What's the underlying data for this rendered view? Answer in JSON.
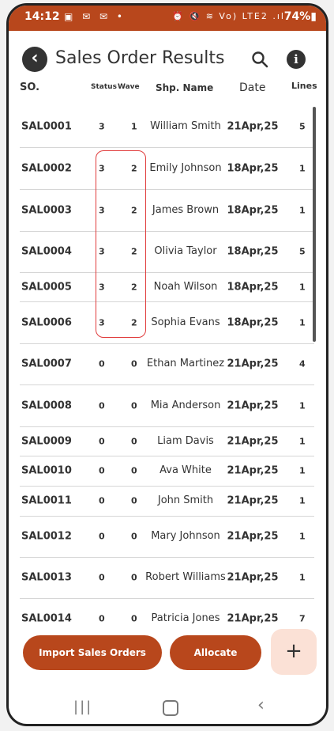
{
  "statusbar": {
    "time": "14:12",
    "left_icons": "▣ ✉ ✉ •",
    "right_icons": "⏰ 🔇 ≋ Vo) LTE2 .ıl",
    "battery": "74%▮"
  },
  "header": {
    "title": "Sales Order Results",
    "back_icon": "back-arrow-icon",
    "search_icon": "search-icon",
    "info_icon": "info-icon"
  },
  "columns": {
    "so": "SO.",
    "status": "Status",
    "wave": "Wave",
    "name": "Shp. Name",
    "date": "Date",
    "lines": "Lines"
  },
  "rows": [
    {
      "so": "SAL0001",
      "status": "3",
      "wave": "1",
      "name": "William Smith",
      "date": "21Apr,25",
      "lines": "5"
    },
    {
      "so": "SAL0002",
      "status": "3",
      "wave": "2",
      "name": "Emily Johnson",
      "date": "18Apr,25",
      "lines": "1"
    },
    {
      "so": "SAL0003",
      "status": "3",
      "wave": "2",
      "name": "James Brown",
      "date": "18Apr,25",
      "lines": "1"
    },
    {
      "so": "SAL0004",
      "status": "3",
      "wave": "2",
      "name": "Olivia Taylor",
      "date": "18Apr,25",
      "lines": "5"
    },
    {
      "so": "SAL0005",
      "status": "3",
      "wave": "2",
      "name": "Noah Wilson",
      "date": "18Apr,25",
      "lines": "1"
    },
    {
      "so": "SAL0006",
      "status": "3",
      "wave": "2",
      "name": "Sophia Evans",
      "date": "18Apr,25",
      "lines": "1"
    },
    {
      "so": "SAL0007",
      "status": "0",
      "wave": "0",
      "name": "Ethan Martinez",
      "date": "21Apr,25",
      "lines": "4"
    },
    {
      "so": "SAL0008",
      "status": "0",
      "wave": "0",
      "name": "Mia Anderson",
      "date": "21Apr,25",
      "lines": "1"
    },
    {
      "so": "SAL0009",
      "status": "0",
      "wave": "0",
      "name": "Liam Davis",
      "date": "21Apr,25",
      "lines": "1"
    },
    {
      "so": "SAL0010",
      "status": "0",
      "wave": "0",
      "name": "Ava White",
      "date": "21Apr,25",
      "lines": "1"
    },
    {
      "so": "SAL0011",
      "status": "0",
      "wave": "0",
      "name": "John Smith",
      "date": "21Apr,25",
      "lines": "1"
    },
    {
      "so": "SAL0012",
      "status": "0",
      "wave": "0",
      "name": "Mary Johnson",
      "date": "21Apr,25",
      "lines": "1"
    },
    {
      "so": "SAL0013",
      "status": "0",
      "wave": "0",
      "name": "Robert Williams",
      "date": "21Apr,25",
      "lines": "1"
    },
    {
      "so": "SAL0014",
      "status": "0",
      "wave": "0",
      "name": "Patricia Jones",
      "date": "21Apr,25",
      "lines": "7"
    }
  ],
  "buttons": {
    "import": "Import Sales Orders",
    "allocate": "Allocate",
    "add": "+"
  },
  "colors": {
    "accent": "#b8471c",
    "add_button_bg": "#fbe1d6",
    "highlight_box": "#e03c3c"
  }
}
